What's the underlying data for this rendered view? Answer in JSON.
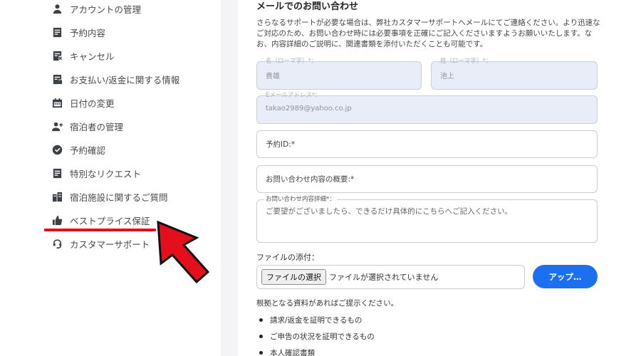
{
  "sidebar": {
    "items": [
      {
        "label": "アカウントの管理",
        "icon": "person-icon"
      },
      {
        "label": "予約内容",
        "icon": "document-icon"
      },
      {
        "label": "キャンセル",
        "icon": "cancel-document-icon"
      },
      {
        "label": "お支払い/返金に関する情報",
        "icon": "payment-document-icon"
      },
      {
        "label": "日付の変更",
        "icon": "calendar-icon"
      },
      {
        "label": "宿泊者の管理",
        "icon": "guests-icon"
      },
      {
        "label": "予約確認",
        "icon": "check-circle-icon"
      },
      {
        "label": "特別なリクエスト",
        "icon": "document-icon"
      },
      {
        "label": "宿泊施設に関するご質問",
        "icon": "building-icon"
      },
      {
        "label": "ベストプライス保証",
        "icon": "thumbs-up-icon"
      },
      {
        "label": "カスタマーサポート",
        "icon": "headset-icon"
      }
    ],
    "highlight_color": "#e3101c"
  },
  "main": {
    "title": "メールでのお問い合わせ",
    "description": "さらなるサポートが必要な場合は、弊社カスタマーサポートへメールにてご連絡ください。より迅速なご対応のため、お問い合わせ時には必要事項を正確にご記入くださいますようお願いいたします。なお、内容詳細のご説明に、関連書類を添付いただくことも可能です。",
    "first_name": {
      "label": "名（ローマ字）*：",
      "value": "貴雄"
    },
    "last_name": {
      "label": "姓（ローマ字）*：",
      "value": "池上"
    },
    "email": {
      "label": "Eメールアドレス*：",
      "value": "takao2989@yahoo.co.jp"
    },
    "booking_id": {
      "placeholder": "予約ID:*"
    },
    "summary": {
      "placeholder": "お問い合わせ内容の概要:*"
    },
    "details": {
      "label": "お問い合わせ内容詳細*：",
      "placeholder": "ご要望がございましたら、できるだけ具体的にこちらへご記入ください。"
    },
    "attachment": {
      "label": "ファイルの添付：",
      "choose_button": "ファイルの選択",
      "status": "ファイルが選択されていません",
      "upload_button": "アップ…"
    },
    "evidence": {
      "intro": "根拠となる資料があればご提示ください。",
      "items": [
        "請求/返金を証明できるもの",
        "ご申告の状況を証明できるもの",
        "本人確認書類"
      ]
    },
    "accent_color": "#1b6ff0"
  }
}
